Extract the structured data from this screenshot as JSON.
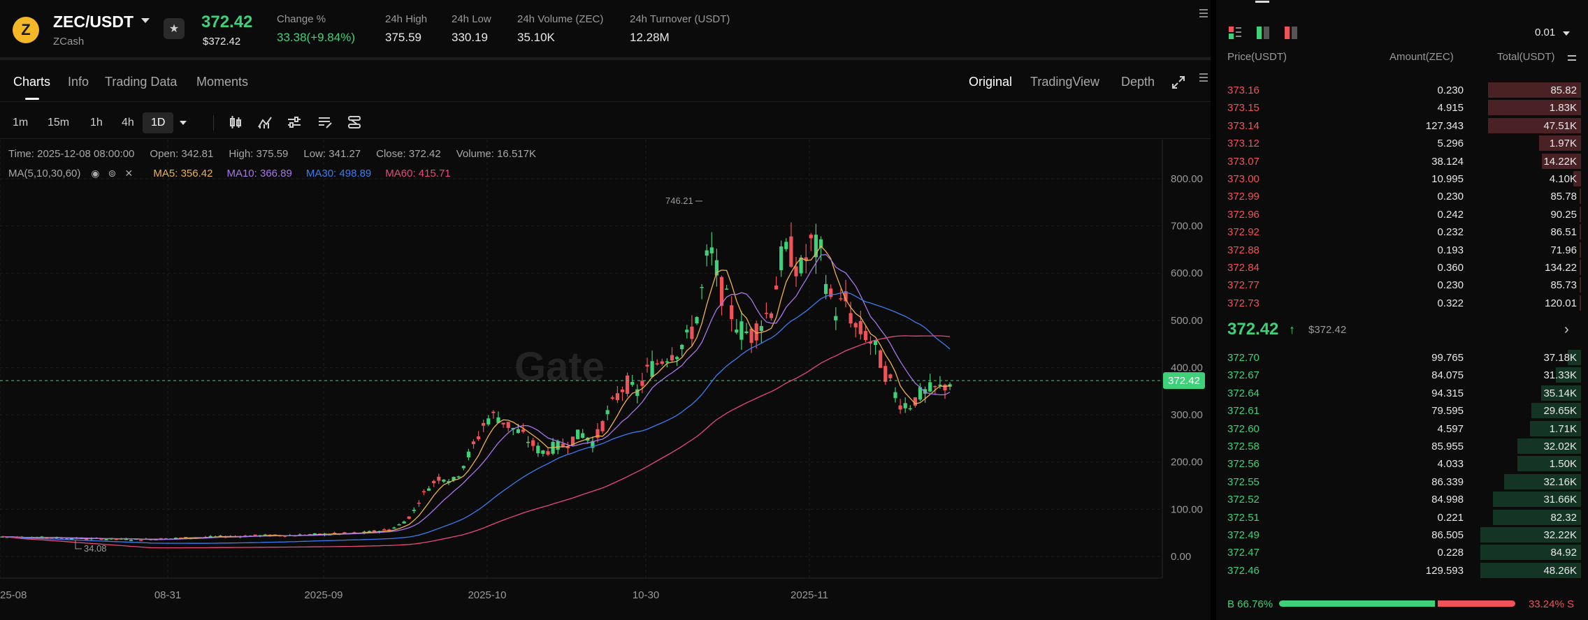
{
  "ticker": {
    "pair": "ZEC/USDT",
    "coin_name": "ZCash",
    "logo_letter": "Z",
    "last_price": "372.42",
    "last_price_usd": "$372.42",
    "stats": [
      {
        "label": "Change %",
        "value": "33.38(+9.84%)",
        "positive": true
      },
      {
        "label": "24h High",
        "value": "375.59"
      },
      {
        "label": "24h Low",
        "value": "330.19"
      },
      {
        "label": "24h Volume (ZEC)",
        "value": "35.10K"
      },
      {
        "label": "24h Turnover (USDT)",
        "value": "12.28M"
      }
    ]
  },
  "tabs": [
    "Charts",
    "Info",
    "Trading Data",
    "Moments"
  ],
  "views": [
    "Original",
    "TradingView",
    "Depth"
  ],
  "timeframes": [
    "1m",
    "15m",
    "1h",
    "4h",
    "1D"
  ],
  "active_timeframe": "1D",
  "tools": [
    "candle-type-icon",
    "indicator-icon",
    "settings-sliders-icon",
    "template-icon",
    "drawing-tools-icon"
  ],
  "candle_info": {
    "time": "Time: 2025-12-08 08:00:00",
    "open": "Open: 342.81",
    "high": "High: 375.59",
    "low": "Low: 341.27",
    "close": "Close: 372.42",
    "volume": "Volume: 16.517K"
  },
  "ma": {
    "label": "MA(5,10,30,60)",
    "ma5": "MA5: 356.42",
    "ma10": "MA10: 366.89",
    "ma30": "MA30: 498.89",
    "ma60": "MA60: 415.71"
  },
  "colors": {
    "up": "#3fd17a",
    "down": "#f0525a",
    "ma5": "#f0b24a",
    "ma10": "#a678e8",
    "ma30": "#3b7df0",
    "ma60": "#e84a78"
  },
  "chart_data": {
    "type": "candlestick",
    "y_ticks": [
      "800.00",
      "700.00",
      "600.00",
      "500.00",
      "400.00",
      "300.00",
      "200.00",
      "100.00",
      "0.00"
    ],
    "x_ticks": [
      "25-08",
      "08-31",
      "2025-09",
      "2025-10",
      "10-30",
      "2025-11"
    ],
    "ylim": [
      -15,
      860
    ],
    "current_price": "372.42",
    "high_annotation": "746.21",
    "low_annotation": "34.08",
    "grid": true
  },
  "orderbook": {
    "precision": "0.01",
    "headers": {
      "price": "Price(USDT)",
      "amount": "Amount(ZEC)",
      "total": "Total(USDT)"
    },
    "asks": [
      {
        "price": "373.16",
        "amount": "0.230",
        "total": "85.82",
        "depth": 0.86
      },
      {
        "price": "373.15",
        "amount": "4.915",
        "total": "1.83K",
        "depth": 0.86
      },
      {
        "price": "373.14",
        "amount": "127.343",
        "total": "47.51K",
        "depth": 0.86
      },
      {
        "price": "373.12",
        "amount": "5.296",
        "total": "1.97K",
        "depth": 0.39
      },
      {
        "price": "373.07",
        "amount": "38.124",
        "total": "14.22K",
        "depth": 0.36
      },
      {
        "price": "373.00",
        "amount": "10.995",
        "total": "4.10K",
        "depth": 0.07
      },
      {
        "price": "372.99",
        "amount": "0.230",
        "total": "85.78",
        "depth": 0.01
      },
      {
        "price": "372.96",
        "amount": "0.242",
        "total": "90.25",
        "depth": 0.01
      },
      {
        "price": "372.92",
        "amount": "0.232",
        "total": "86.51",
        "depth": 0.01
      },
      {
        "price": "372.88",
        "amount": "0.193",
        "total": "71.96",
        "depth": 0.01
      },
      {
        "price": "372.84",
        "amount": "0.360",
        "total": "134.22",
        "depth": 0.01
      },
      {
        "price": "372.77",
        "amount": "0.230",
        "total": "85.73",
        "depth": 0.01
      },
      {
        "price": "372.73",
        "amount": "0.322",
        "total": "120.01",
        "depth": 0.01
      }
    ],
    "mid": {
      "price": "372.42",
      "arrow": "↑",
      "usd": "$372.42"
    },
    "bids": [
      {
        "price": "372.70",
        "amount": "99.765",
        "total": "37.18K",
        "depth": 0.12
      },
      {
        "price": "372.67",
        "amount": "84.075",
        "total": "31.33K",
        "depth": 0.23
      },
      {
        "price": "372.64",
        "amount": "94.315",
        "total": "35.14K",
        "depth": 0.37
      },
      {
        "price": "372.61",
        "amount": "79.595",
        "total": "29.65K",
        "depth": 0.46
      },
      {
        "price": "372.60",
        "amount": "4.597",
        "total": "1.71K",
        "depth": 0.47
      },
      {
        "price": "372.58",
        "amount": "85.955",
        "total": "32.02K",
        "depth": 0.59
      },
      {
        "price": "372.56",
        "amount": "4.033",
        "total": "1.50K",
        "depth": 0.59
      },
      {
        "price": "372.55",
        "amount": "86.339",
        "total": "32.16K",
        "depth": 0.71
      },
      {
        "price": "372.52",
        "amount": "84.998",
        "total": "31.66K",
        "depth": 0.81
      },
      {
        "price": "372.51",
        "amount": "0.221",
        "total": "82.32",
        "depth": 0.81
      },
      {
        "price": "372.49",
        "amount": "86.505",
        "total": "32.22K",
        "depth": 0.93
      },
      {
        "price": "372.47",
        "amount": "0.228",
        "total": "84.92",
        "depth": 0.93
      },
      {
        "price": "372.46",
        "amount": "129.593",
        "total": "48.26K",
        "depth": 0.93
      }
    ],
    "buy_ratio": "B 66.76%",
    "sell_ratio": "33.24% S",
    "buy_fraction": 0.6676
  }
}
